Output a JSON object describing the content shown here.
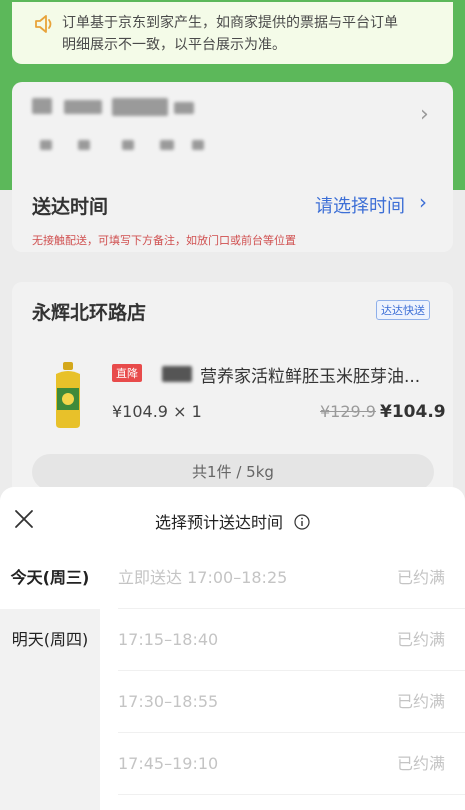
{
  "notice": {
    "line1": "订单基于京东到家产生，如商家提供的票据与平台订单",
    "line2": "明细展示不一致，以平台展示为准。"
  },
  "delivery": {
    "title": "送达时间",
    "select_label": "请选择时间",
    "note": "无接触配送，可填写下方备注，如放门口或前台等位置"
  },
  "store": {
    "name": "永辉北环路店",
    "badge": "达达快送",
    "product": {
      "tag": "直降",
      "name": "营养家活粒鲜胚玉米胚芽油...",
      "qty_price": "¥104.9 × 1",
      "old_price": "¥129.9",
      "price": "¥104.9"
    },
    "total": "共1件 / 5kg"
  },
  "sheet": {
    "title": "选择预计送达时间",
    "days": [
      {
        "label": "今天(周三)",
        "active": true
      },
      {
        "label": "明天(周四)",
        "active": false
      }
    ],
    "slots": [
      {
        "time": "立即送达 17:00–18:25",
        "status": "已约满"
      },
      {
        "time": "17:15–18:40",
        "status": "已约满"
      },
      {
        "time": "17:30–18:55",
        "status": "已约满"
      },
      {
        "time": "17:45–19:10",
        "status": "已约满"
      }
    ]
  },
  "colors": {
    "brand_green": "#5cb85a",
    "link_blue": "#3d6fd6",
    "warn_red": "#d05050",
    "disabled_text": "#c4c4c4"
  },
  "icons": [
    "speaker-icon",
    "chevron-right-icon",
    "close-icon",
    "info-icon"
  ]
}
